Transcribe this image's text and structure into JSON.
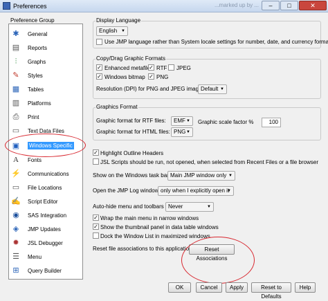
{
  "window": {
    "title": "Preferences",
    "ghost_text": "...marked up by ..."
  },
  "sidebar": {
    "group_label": "Preference Group",
    "items": [
      {
        "label": "General",
        "icon": "general-icon"
      },
      {
        "label": "Reports",
        "icon": "reports-icon"
      },
      {
        "label": "Graphs",
        "icon": "graphs-icon"
      },
      {
        "label": "Styles",
        "icon": "styles-icon"
      },
      {
        "label": "Tables",
        "icon": "tables-icon"
      },
      {
        "label": "Platforms",
        "icon": "platforms-icon"
      },
      {
        "label": "Print",
        "icon": "print-icon"
      },
      {
        "label": "Text Data Files",
        "icon": "text-data-files-icon"
      },
      {
        "label": "Windows Specific",
        "icon": "windows-specific-icon",
        "selected": true
      },
      {
        "label": "Fonts",
        "icon": "fonts-icon"
      },
      {
        "label": "Communications",
        "icon": "communications-icon"
      },
      {
        "label": "File Locations",
        "icon": "file-locations-icon"
      },
      {
        "label": "Script Editor",
        "icon": "script-editor-icon"
      },
      {
        "label": "SAS Integration",
        "icon": "sas-integration-icon"
      },
      {
        "label": "JMP Updates",
        "icon": "jmp-updates-icon"
      },
      {
        "label": "JSL Debugger",
        "icon": "jsl-debugger-icon"
      },
      {
        "label": "Menu",
        "icon": "menu-icon"
      },
      {
        "label": "Query Builder",
        "icon": "query-builder-icon"
      }
    ]
  },
  "display_language": {
    "title": "Display Language",
    "selected": "English",
    "use_jmp_language_label": "Use JMP language rather than System locale settings for number, date, and currency formats",
    "use_jmp_language_checked": false
  },
  "copy_drag": {
    "title": "Copy/Drag Graphic Formats",
    "checkboxes": [
      {
        "label": "Enhanced metafile",
        "checked": true
      },
      {
        "label": "RTF",
        "checked": true
      },
      {
        "label": "JPEG",
        "checked": false
      },
      {
        "label": "Windows bitmap",
        "checked": true
      },
      {
        "label": "PNG",
        "checked": true
      }
    ],
    "resolution_label": "Resolution (DPI) for PNG and JPEG images:",
    "resolution_value": "Default"
  },
  "graphics_format": {
    "title": "Graphics Format",
    "rtf_label": "Graphic format for RTF files:",
    "rtf_value": "EMF",
    "html_label": "Graphic format for HTML files:",
    "html_value": "PNG",
    "scale_label": "Graphic scale factor %",
    "scale_value": "100"
  },
  "options": {
    "highlight_outline": {
      "label": "Highlight Outline Headers",
      "checked": true
    },
    "jsl_scripts": {
      "label": "JSL Scripts should be run, not opened, when selected from Recent Files or a file browser",
      "checked": false
    },
    "taskbar_label": "Show on the Windows task bar:",
    "taskbar_value": "Main JMP window only",
    "log_label": "Open the JMP Log window",
    "log_value": "only when I explicitly open it",
    "autohide_label": "Auto-hide menu and toolbars",
    "autohide_value": "Never",
    "wrap_menu": {
      "label": "Wrap the main menu in narrow windows",
      "checked": true
    },
    "thumbnail": {
      "label": "Show the thumbnail panel in data table windows",
      "checked": true
    },
    "dock_window": {
      "label": "Dock the Window List in maximized windows",
      "checked": false
    },
    "reset_label": "Reset file associations to this application:",
    "reset_button": "Reset Associations"
  },
  "footer": {
    "ok": "OK",
    "cancel": "Cancel",
    "apply": "Apply",
    "reset_defaults": "Reset to Defaults",
    "help": "Help"
  },
  "colors": {
    "selection": "#3399ff",
    "annotation": "#d8262e"
  }
}
